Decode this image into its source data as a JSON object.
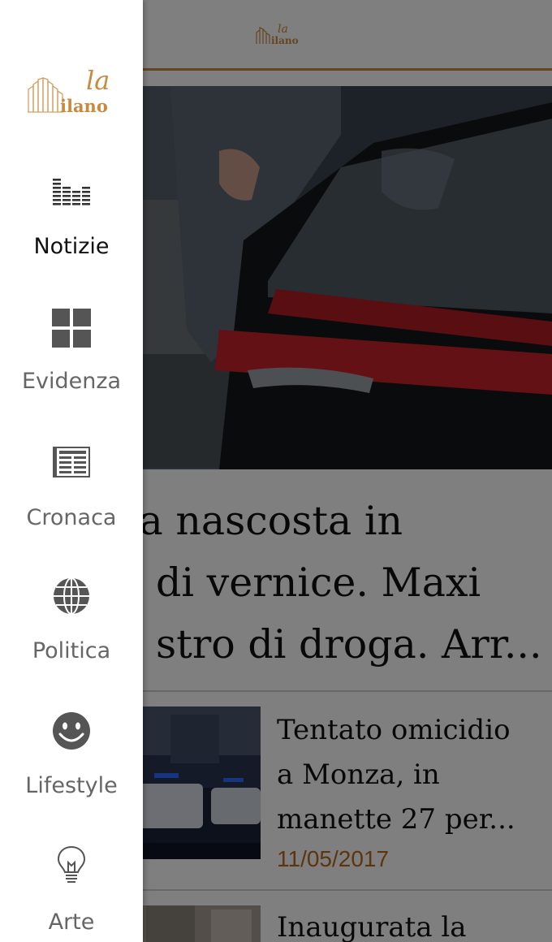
{
  "brand": {
    "logo_top": "la",
    "logo_bottom": "ilano"
  },
  "hero": {
    "title_lines": [
      "na nascosta in",
      "di vernice. Maxi",
      "stro di droga. Arr..."
    ]
  },
  "articles": [
    {
      "title_lines": [
        "Tentato omicidio",
        "a Monza, in",
        "manette 27 per..."
      ],
      "date": "11/05/2017"
    },
    {
      "title_lines": [
        "Inaugurata la"
      ],
      "date": ""
    }
  ],
  "drawer": {
    "items": [
      {
        "label": "Notizie",
        "icon": "equalizer-icon",
        "active": true
      },
      {
        "label": "Evidenza",
        "icon": "grid-icon",
        "active": false
      },
      {
        "label": "Cronaca",
        "icon": "newspaper-icon",
        "active": false
      },
      {
        "label": "Politica",
        "icon": "globe-icon",
        "active": false
      },
      {
        "label": "Lifestyle",
        "icon": "smiley-icon",
        "active": false
      },
      {
        "label": "Arte",
        "icon": "lightbulb-icon",
        "active": false
      }
    ]
  },
  "colors": {
    "accent": "#c98a3f",
    "date": "#b86a1e",
    "icon": "#555555",
    "overlay": "rgba(0,0,0,0.5)"
  }
}
